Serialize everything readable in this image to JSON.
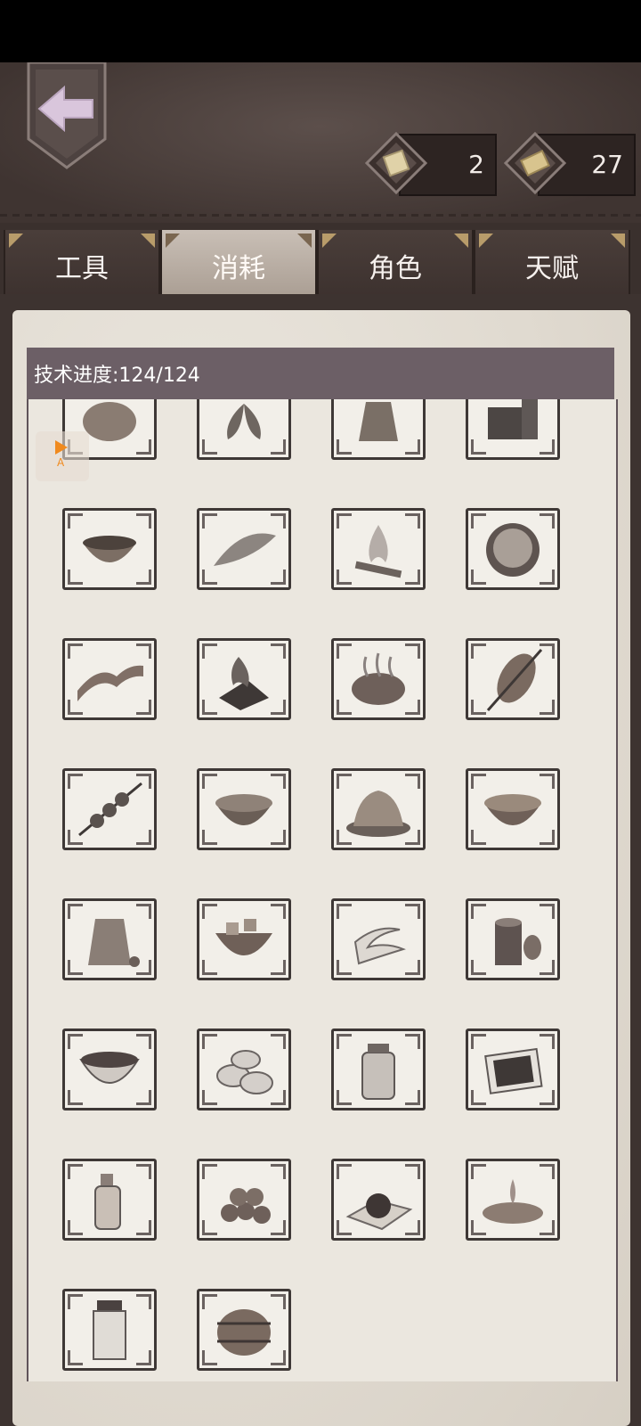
{
  "currencies": [
    {
      "icon": "scroll-gem-icon",
      "value": "2"
    },
    {
      "icon": "parchment-gem-icon",
      "value": "27"
    }
  ],
  "tabs": [
    {
      "label": "工具",
      "active": false
    },
    {
      "label": "消耗",
      "active": true
    },
    {
      "label": "角色",
      "active": false
    },
    {
      "label": "天赋",
      "active": false
    }
  ],
  "progress_label": "技术进度:124/124",
  "side_marker": {
    "text": "A"
  },
  "items": [
    "potato-icon",
    "herb-leaves-icon",
    "grain-sack-icon",
    "charcoal-pile-icon",
    "stew-bowl-icon",
    "dried-fish-icon",
    "campfire-icon",
    "fried-rice-bowl-icon",
    "bacon-strip-icon",
    "burnt-wood-icon",
    "grilled-steak-icon",
    "roast-skewer-icon",
    "kebab-icon",
    "bean-soup-icon",
    "cooked-meal-icon",
    "broth-bowl-icon",
    "spice-sack-icon",
    "meat-stew-icon",
    "bandage-roll-icon",
    "cocoa-can-icon",
    "tea-bowl-icon",
    "rice-cake-icon",
    "pickle-jar-icon",
    "seaweed-sheet-icon",
    "oil-bottle-icon",
    "nut-pile-icon",
    "chocolate-ball-icon",
    "syrup-splash-icon",
    "medicine-bottle-icon",
    "barrel-icon"
  ],
  "colors": {
    "header_bg": "#6c5f66",
    "tab_active": "#c9bfb6",
    "leather": "#4a3e3a",
    "parchment": "#e6e1d8"
  }
}
